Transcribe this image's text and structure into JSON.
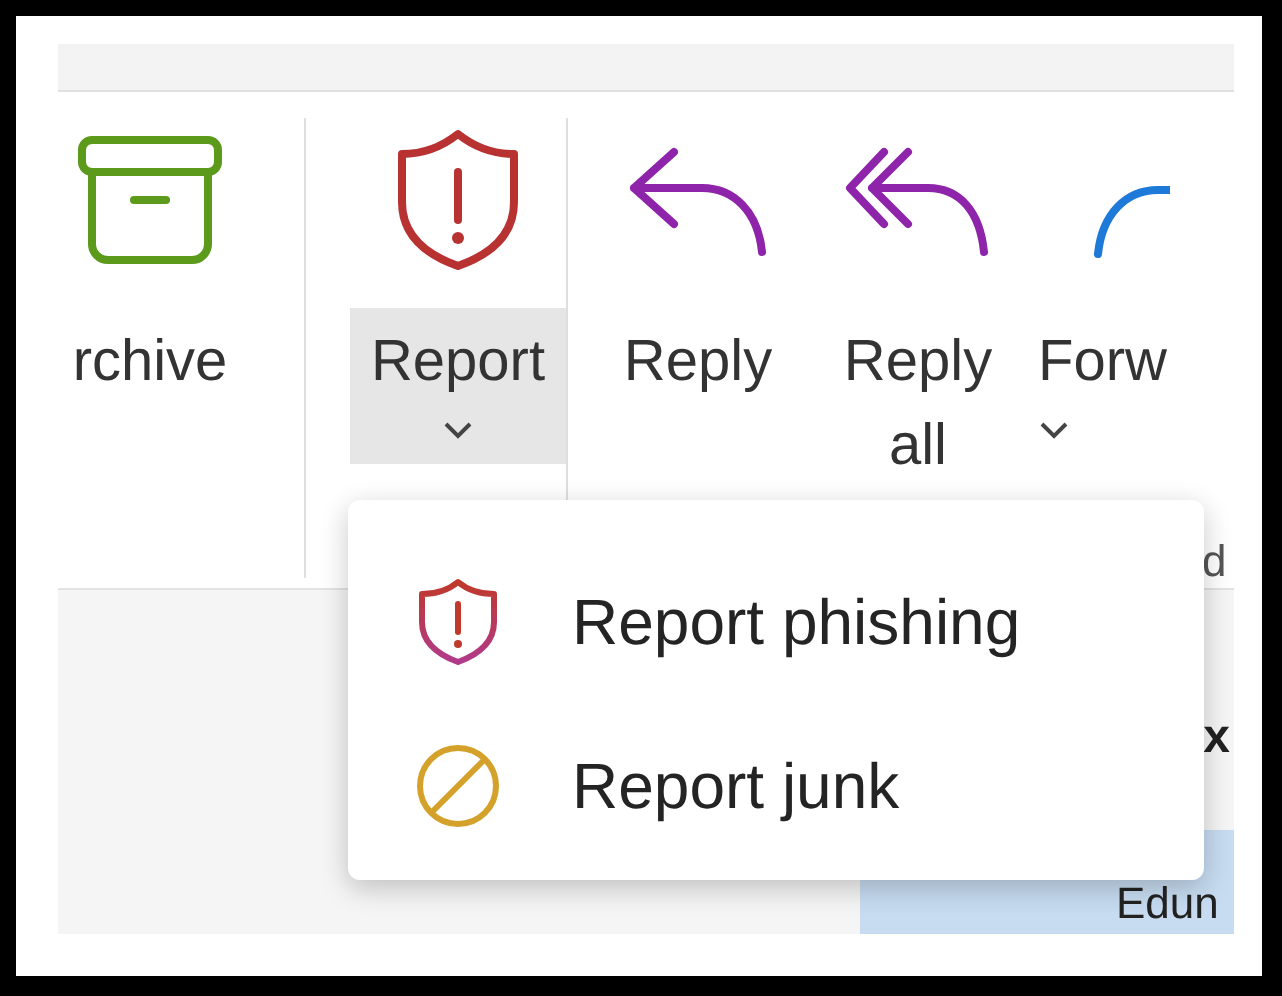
{
  "ribbon": {
    "items": [
      {
        "kind": "archive",
        "lines": [
          "rchive"
        ],
        "dropdown": false,
        "pressed": false
      },
      {
        "kind": "separator"
      },
      {
        "kind": "report",
        "lines": [
          "Report"
        ],
        "dropdown": true,
        "pressed": true
      },
      {
        "kind": "separator"
      },
      {
        "kind": "reply",
        "lines": [
          "Reply"
        ],
        "dropdown": false,
        "pressed": false
      },
      {
        "kind": "reply-all",
        "lines": [
          "Reply",
          "all"
        ],
        "dropdown": false,
        "pressed": false
      },
      {
        "kind": "forward",
        "lines": [
          "Forw"
        ],
        "dropdown": true,
        "pressed": false
      }
    ],
    "group_label": "d"
  },
  "message_list": {
    "items": [
      {
        "text": "x",
        "selected": false
      },
      {
        "text": "Edun",
        "selected": true
      }
    ]
  },
  "menu": {
    "items": [
      {
        "kind": "phishing",
        "label": "Report phishing"
      },
      {
        "kind": "junk",
        "label": "Report junk"
      }
    ]
  }
}
